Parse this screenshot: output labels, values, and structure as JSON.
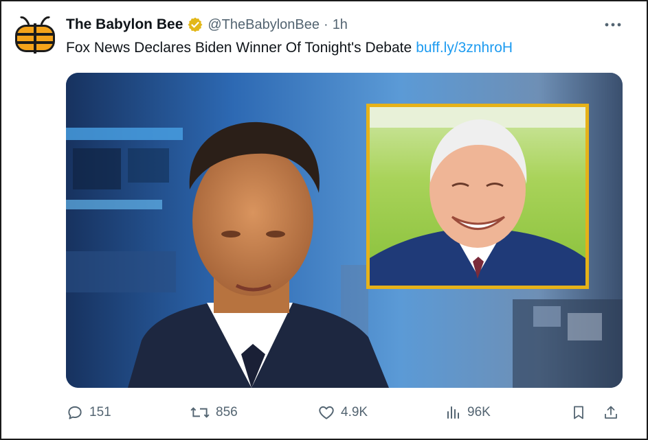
{
  "account": {
    "display_name": "The Babylon Bee",
    "handle": "@TheBabylonBee",
    "separator": "·",
    "time": "1h",
    "verified_color": "#e2b719",
    "logo_color": "#f5a31a"
  },
  "tweet": {
    "text": "Fox News Declares Biden Winner Of Tonight's Debate",
    "link": "buff.ly/3znhroH"
  },
  "media": {
    "inset_border_color": "#e6b219"
  },
  "actions": {
    "replies": "151",
    "reposts": "856",
    "likes": "4.9K",
    "views": "96K"
  },
  "icons": {
    "reply": "reply-icon",
    "repost": "repost-icon",
    "like": "heart-icon",
    "views": "views-icon",
    "bookmark": "bookmark-icon",
    "share": "share-icon",
    "more": "more-icon"
  }
}
